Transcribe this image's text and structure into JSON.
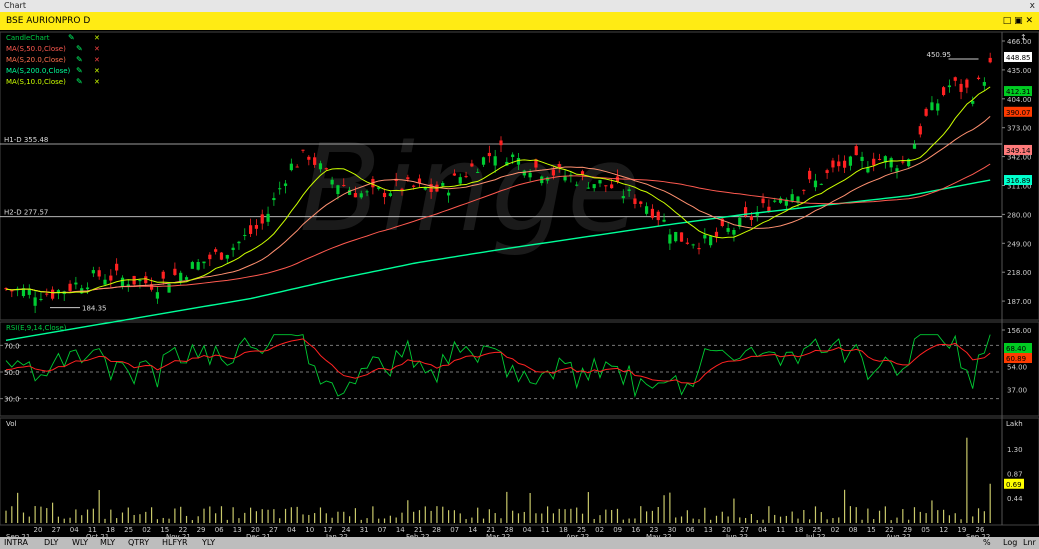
{
  "window": {
    "title": "Chart",
    "close_label": "x"
  },
  "symbol": {
    "title": "BSE AURIONPRO D",
    "icons": "□ ▣ ✕"
  },
  "price_panel": {
    "legend": [
      {
        "label": "CandleChart",
        "color": "#00cc44"
      },
      {
        "label": "MA(S,50.0,Close)",
        "color": "#ff5a50"
      },
      {
        "label": "MA(S,20.0,Close)",
        "color": "#ff7050"
      },
      {
        "label": "MA(S,200.0,Close)",
        "color": "#00ff99"
      },
      {
        "label": "MA(S,10.0,Close)",
        "color": "#ccff00"
      }
    ],
    "y_ticks": [
      "466.00",
      "435.00",
      "404.00",
      "373.00",
      "342.00",
      "311.00",
      "280.00",
      "249.00",
      "218.00",
      "187.00",
      "156.00"
    ],
    "hlines": [
      {
        "label": "H1-D 355.48",
        "value": 355.48
      },
      {
        "label": "H2-D 277.57",
        "value": 277.57
      }
    ],
    "annotations": {
      "high": "450.95",
      "low": "184.35"
    },
    "price_badges": [
      {
        "text": "448.85",
        "bg": "#ffffff",
        "fg": "#000000",
        "value": 448.85
      },
      {
        "text": "412.31",
        "bg": "#00cc22",
        "fg": "#000000",
        "value": 412.31
      },
      {
        "text": "390.07",
        "bg": "#ff3b00",
        "fg": "#000000",
        "value": 390.07
      },
      {
        "text": "349.14",
        "bg": "#ff7a7a",
        "fg": "#000000",
        "value": 349.14
      },
      {
        "text": "316.89",
        "bg": "#00ffcc",
        "fg": "#000000",
        "value": 316.89
      }
    ],
    "watermark": "Binge"
  },
  "rsi_panel": {
    "legend": "RSI(E,9,14,Close)",
    "levels": [
      "70.0",
      "50.0",
      "30.0"
    ],
    "y_ticks": [
      "54.00",
      "37.00"
    ],
    "badges": [
      {
        "text": "68.40",
        "bg": "#00cc22"
      },
      {
        "text": "60.89",
        "bg": "#ff3b00"
      }
    ]
  },
  "vol_panel": {
    "legend": "Vol",
    "unit": "Lakh",
    "y_ticks": [
      "1.30",
      "0.87",
      "0.44"
    ],
    "badge": {
      "text": "0.69",
      "bg": "#ffff00"
    }
  },
  "x_axis": {
    "day_ticks": [
      "20",
      "27",
      "04",
      "11",
      "18",
      "25",
      "02",
      "15",
      "22",
      "29",
      "06",
      "13",
      "20",
      "27",
      "04",
      "10",
      "17",
      "24",
      "31",
      "07",
      "14",
      "21",
      "28",
      "07",
      "14",
      "21",
      "28",
      "04",
      "11",
      "18",
      "25",
      "02",
      "09",
      "16",
      "23",
      "30",
      "06",
      "13",
      "20",
      "27",
      "04",
      "11",
      "18",
      "25",
      "02",
      "08",
      "15",
      "22",
      "29",
      "05",
      "12",
      "19",
      "26"
    ],
    "months": [
      "Sep 21",
      "Oct 21",
      "Nov 21",
      "Dec 21",
      "Jan 22",
      "Feb 22",
      "Mar 22",
      "Apr 22",
      "May 22",
      "Jun 22",
      "Jul 22",
      "Aug 22",
      "Sep 22"
    ]
  },
  "bottom_bar": {
    "periods": [
      "INTRA",
      "DLY",
      "WLY",
      "MLY",
      "QTRY",
      "HLFYR",
      "YLY"
    ],
    "right": [
      "%",
      "Log",
      "Lnr"
    ]
  },
  "chart_data": {
    "type": "candlestick",
    "series": [
      {
        "name": "MA(S,200.0,Close)",
        "x": [
          "Sep 21",
          "Oct 21",
          "Nov 21",
          "Dec 21",
          "Jan 22",
          "Feb 22",
          "Mar 22",
          "Apr 22",
          "May 22",
          "Jun 22",
          "Jul 22",
          "Aug 22",
          "Sep 22"
        ],
        "values": [
          145,
          160,
          175,
          190,
          210,
          228,
          242,
          255,
          268,
          280,
          290,
          300,
          316.89
        ]
      },
      {
        "name": "MA(S,50.0,Close)",
        "x": [
          "Sep 21",
          "Oct 21",
          "Nov 21",
          "Dec 21",
          "Jan 22",
          "Feb 22",
          "Mar 22",
          "Apr 22",
          "May 22",
          "Jun 22",
          "Jul 22",
          "Aug 22",
          "Sep 22"
        ],
        "values": [
          188,
          195,
          205,
          215,
          250,
          300,
          310,
          330,
          325,
          300,
          275,
          285,
          349.14
        ]
      }
    ]
  }
}
